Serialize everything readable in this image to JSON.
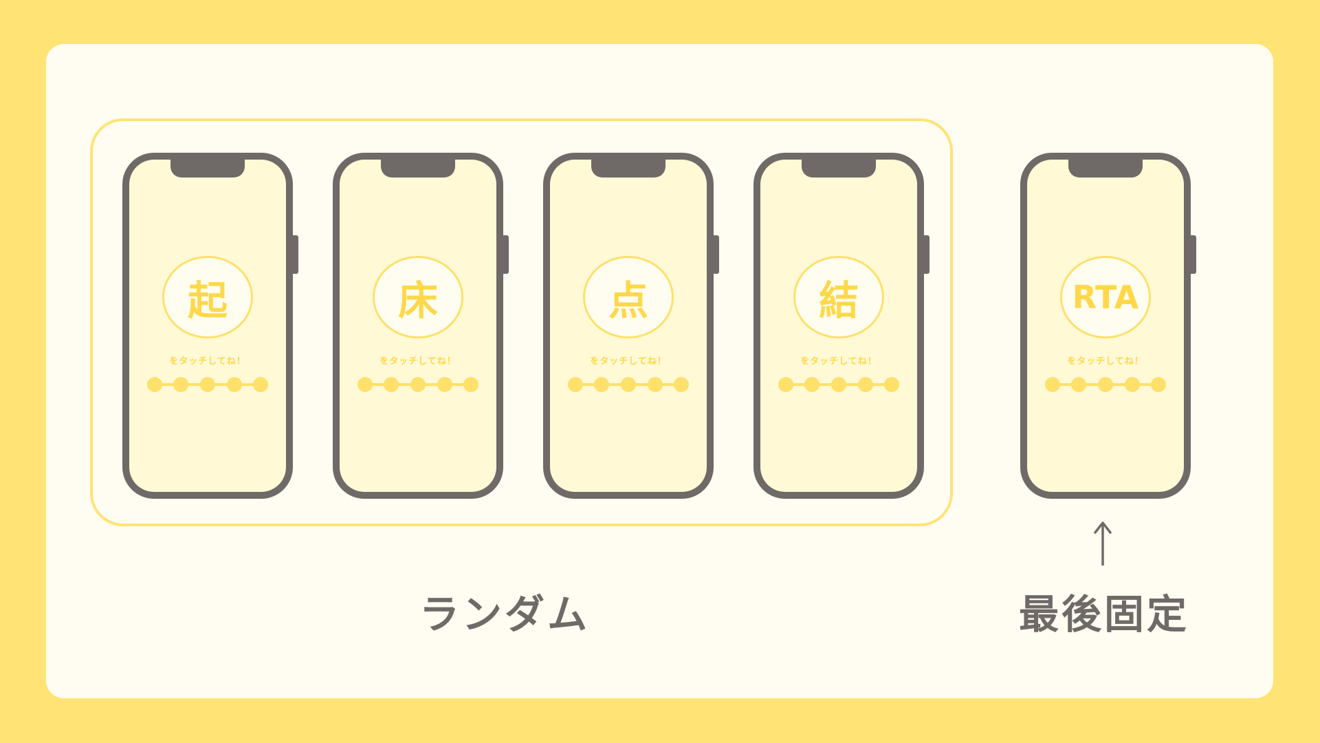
{
  "phones": [
    {
      "glyph": "起",
      "hint": "をタッチしてね！"
    },
    {
      "glyph": "床",
      "hint": "をタッチしてね！"
    },
    {
      "glyph": "点",
      "hint": "をタッチしてね！"
    },
    {
      "glyph": "結",
      "hint": "をタッチしてね！"
    },
    {
      "glyph": "RTA",
      "hint": "をタッチしてね！"
    }
  ],
  "labels": {
    "random": "ランダム",
    "fixed_last": "最後固定"
  },
  "colors": {
    "background": "#FFE475",
    "card": "#FFFCF2",
    "phone_frame": "#6F6A67",
    "screen": "#FFF9D6",
    "accent": "#FFD84A"
  }
}
